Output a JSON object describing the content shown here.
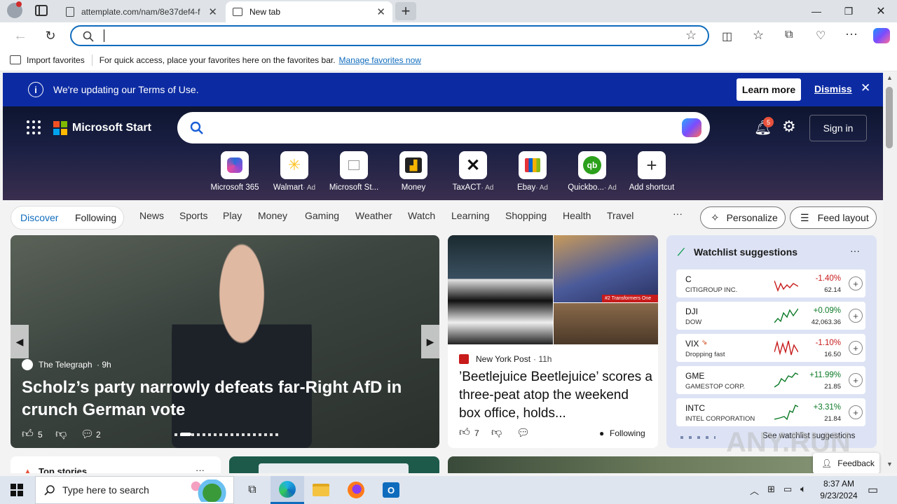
{
  "browser": {
    "tabs": [
      {
        "title": "attemplate.com/nam/8e37def4-f",
        "active": false
      },
      {
        "title": "New tab",
        "active": true
      }
    ],
    "favorites_bar": {
      "import_label": "Import favorites",
      "hint": "For quick access, place your favorites here on the favorites bar.",
      "manage_link": "Manage favorites now"
    },
    "address_value": ""
  },
  "terms_banner": {
    "text": "We're updating our Terms of Use.",
    "learn_more": "Learn more",
    "dismiss": "Dismiss"
  },
  "header": {
    "brand": "Microsoft Start",
    "notification_count": "5",
    "sign_in": "Sign in"
  },
  "quick_links": [
    {
      "label": "Microsoft 365",
      "ad": ""
    },
    {
      "label": "Walmart",
      "ad": "· Ad"
    },
    {
      "label": "Microsoft St...",
      "ad": ""
    },
    {
      "label": "Money",
      "ad": ""
    },
    {
      "label": "TaxACT",
      "ad": "· Ad"
    },
    {
      "label": "Ebay",
      "ad": "· Ad"
    },
    {
      "label": "Quickbo...",
      "ad": "· Ad"
    },
    {
      "label": "Add shortcut",
      "ad": ""
    }
  ],
  "feed_tabs": [
    "Discover",
    "Following"
  ],
  "categories": [
    "News",
    "Sports",
    "Play",
    "Money",
    "Gaming",
    "Weather",
    "Watch",
    "Learning",
    "Shopping",
    "Health",
    "Travel"
  ],
  "more_label": "···",
  "personalize": "Personalize",
  "feed_layout": "Feed layout",
  "hero_story": {
    "source": "The Telegraph",
    "age": "· 9h",
    "headline": "Scholz’s party narrowly defeats far-Right AfD in crunch German vote",
    "likes": "5",
    "comments": "2"
  },
  "side_story": {
    "source": "New York Post",
    "age": "· 11h",
    "headline": "’Beetlejuice Beetlejuice’ scores a three-peat atop the weekend box office, holds...",
    "likes": "7",
    "following": "Following",
    "image_caption": "#2 Transformers One"
  },
  "watchlist": {
    "title": "Watchlist suggestions",
    "see_more": "See watchlist suggestions",
    "stocks": [
      {
        "symbol": "C",
        "name": "CITIGROUP INC.",
        "change": "-1.40%",
        "price": "62.14",
        "trend": "down"
      },
      {
        "symbol": "DJI",
        "name": "DOW",
        "change": "+0.09%",
        "price": "42,063.36",
        "trend": "up"
      },
      {
        "symbol": "VIX",
        "name": "Dropping fast",
        "change": "-1.10%",
        "price": "16.50",
        "trend": "down"
      },
      {
        "symbol": "GME",
        "name": "GAMESTOP CORP.",
        "change": "+11.99%",
        "price": "21.85",
        "trend": "up"
      },
      {
        "symbol": "INTC",
        "name": "INTEL CORPORATION",
        "change": "+3.31%",
        "price": "21.84",
        "trend": "up"
      }
    ]
  },
  "top_stories_label": "Top stories",
  "feedback": "Feedback",
  "watermark": "ANY.RUN",
  "taskbar": {
    "search_placeholder": "Type here to search",
    "time": "8:37 AM",
    "date": "9/23/2024"
  },
  "colors": {
    "accent": "#0f6cbd",
    "banner": "#0c2ba3",
    "up": "#0b7a26",
    "down": "#c81b1b"
  }
}
